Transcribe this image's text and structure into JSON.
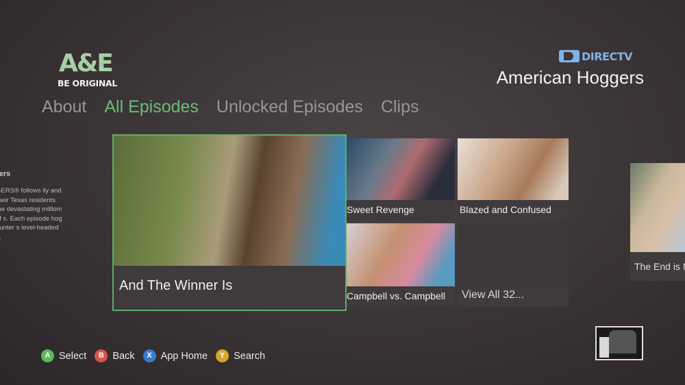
{
  "logo": {
    "brand": "A&E",
    "tagline": "BE ORIGINAL"
  },
  "provider": {
    "name": "DIRECTV"
  },
  "show_title": "American Hoggers",
  "nav": {
    "tabs": [
      {
        "label": "About",
        "active": false
      },
      {
        "label": "All Episodes",
        "active": true
      },
      {
        "label": "Unlocked Episodes",
        "active": false
      },
      {
        "label": "Clips",
        "active": false
      }
    ]
  },
  "side_description": {
    "title": "gers",
    "body": "GERS® follows ily and their Texas residents the devastating millions of s. Each episode hog hunter s level-headed ..."
  },
  "episodes": {
    "featured": {
      "title": "And The Winner Is"
    },
    "tiles": [
      {
        "title": "Sweet Revenge"
      },
      {
        "title": "Blazed and Confused"
      },
      {
        "title": "Campbell vs. Campbell"
      }
    ],
    "view_all": "View All 32...",
    "next_partial": {
      "title": "The End is N"
    }
  },
  "controller_hints": [
    {
      "button": "A",
      "label": "Select"
    },
    {
      "button": "B",
      "label": "Back"
    },
    {
      "button": "X",
      "label": "App Home"
    },
    {
      "button": "Y",
      "label": "Search"
    }
  ],
  "colors": {
    "accent_green": "#6bbf75",
    "directv_blue": "#7db3e8",
    "button_a": "#5cb85c",
    "button_b": "#d9534f",
    "button_x": "#3a7bc8",
    "button_y": "#d4a72c"
  }
}
